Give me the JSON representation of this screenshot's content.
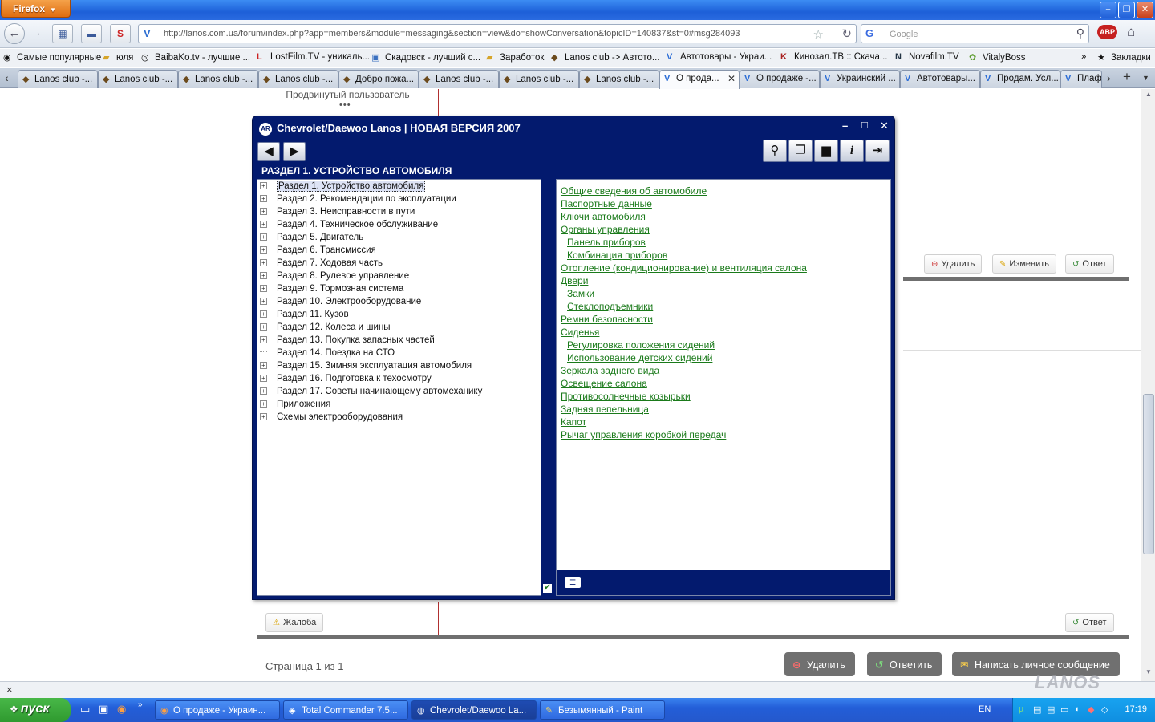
{
  "browser": {
    "menu_label": "Firefox",
    "url": "http://lanos.com.ua/forum/index.php?app=members&module=messaging&section=view&do=showConversation&topicID=140837&st=0#msg284093",
    "search_placeholder": "Google",
    "abp_label": "ABP",
    "bookmarks": [
      "Самые популярные",
      "юля",
      "BaibaKo.tv - лучшие ...",
      "LostFilm.TV - уникаль...",
      "Скадовск - лучший с...",
      "Заработок",
      "Lanos club -> Автото...",
      "Автотовары - Украи...",
      "Кинозал.ТВ :: Скача...",
      "Novafilm.TV",
      "VitalyBoss"
    ],
    "bookmarks_menu": "Закладки",
    "tabs": [
      "Lanos club -...",
      "Lanos club -...",
      "Lanos club -...",
      "Lanos club -...",
      "Добро пожа...",
      "Lanos club -...",
      "Lanos club -...",
      "Lanos club -...",
      "О прода...",
      "О продаже -...",
      "Украинский ...",
      "Автотовары...",
      "Продам. Усл...",
      "Плаф"
    ],
    "status_close": "×"
  },
  "forum": {
    "user_group": "Продвинутый пользователь",
    "dots": "•••",
    "delete_small": "Удалить",
    "edit_small": "Изменить",
    "reply_small": "Ответ",
    "reply_small_2": "Ответ",
    "complaint": "Жалоба",
    "page_label": "Страница 1 из 1",
    "btn_delete": "Удалить",
    "btn_reply": "Ответить",
    "btn_new_pm": "Написать личное сообщение"
  },
  "app": {
    "title": "Chevrolet/Daewoo Lanos | НОВАЯ ВЕРСИЯ 2007",
    "logo_text": "AR",
    "section_title": "РАЗДЕЛ 1. УСТРОЙСТВО АВТОМОБИЛЯ",
    "tree": [
      {
        "label": "Раздел 1. Устройство автомобиля",
        "expandable": true,
        "selected": true
      },
      {
        "label": "Раздел 2. Рекомендации по эксплуатации",
        "expandable": true
      },
      {
        "label": "Раздел 3. Неисправности в пути",
        "expandable": true
      },
      {
        "label": "Раздел 4. Техническое обслуживание",
        "expandable": true
      },
      {
        "label": "Раздел 5. Двигатель",
        "expandable": true
      },
      {
        "label": "Раздел 6. Трансмиссия",
        "expandable": true
      },
      {
        "label": "Раздел 7. Ходовая часть",
        "expandable": true
      },
      {
        "label": "Раздел 8. Рулевое управление",
        "expandable": true
      },
      {
        "label": "Раздел 9. Тормозная система",
        "expandable": true
      },
      {
        "label": "Раздел 10. Электрооборудование",
        "expandable": true
      },
      {
        "label": "Раздел 11. Кузов",
        "expandable": true
      },
      {
        "label": "Раздел 12. Колеса и шины",
        "expandable": true
      },
      {
        "label": "Раздел 13. Покупка запасных частей",
        "expandable": true
      },
      {
        "label": "Раздел 14. Поездка на СТО",
        "expandable": false
      },
      {
        "label": "Раздел 15. Зимняя эксплуатация автомобиля",
        "expandable": true
      },
      {
        "label": "Раздел 16. Подготовка к техосмотру",
        "expandable": true
      },
      {
        "label": "Раздел 17. Советы начинающему автомеханику",
        "expandable": true
      },
      {
        "label": "Приложения",
        "expandable": true
      },
      {
        "label": "Схемы электрооборудования",
        "expandable": true
      }
    ],
    "links": [
      {
        "label": "Общие сведения об автомобиле",
        "indent": false
      },
      {
        "label": "Паспортные данные",
        "indent": false
      },
      {
        "label": "Ключи автомобиля",
        "indent": false
      },
      {
        "label": "Органы управления",
        "indent": false
      },
      {
        "label": "Панель приборов",
        "indent": true
      },
      {
        "label": "Комбинация приборов",
        "indent": true
      },
      {
        "label": "Отопление (кондиционирование) и вентиляция салона",
        "indent": false
      },
      {
        "label": "Двери",
        "indent": false
      },
      {
        "label": "Замки",
        "indent": true
      },
      {
        "label": "Стеклоподъемники",
        "indent": true
      },
      {
        "label": "Ремни безопасности",
        "indent": false
      },
      {
        "label": "Сиденья",
        "indent": false
      },
      {
        "label": "Регулировка положения сидений",
        "indent": true
      },
      {
        "label": "Использование детских сидений",
        "indent": true
      },
      {
        "label": "Зеркала заднего вида",
        "indent": false
      },
      {
        "label": "Освещение салона",
        "indent": false
      },
      {
        "label": "Противосолнечные козырьки",
        "indent": false
      },
      {
        "label": "Задняя пепельница",
        "indent": false
      },
      {
        "label": "Капот",
        "indent": false
      },
      {
        "label": "Рычаг управления коробкой передач",
        "indent": false
      }
    ]
  },
  "taskbar": {
    "start_label": "пуск",
    "windows": [
      "О продаже - Украин...",
      "Total Commander 7.5...",
      "Chevrolet/Daewoo La...",
      "Безымянный - Paint"
    ],
    "lang": "EN",
    "clock": "17:19"
  },
  "watermark": "LANOS",
  "colors": {
    "app_bg": "#031a6e",
    "link": "#1a7a1a",
    "taskbar": "#235ed8",
    "start": "#2f9a2f"
  }
}
